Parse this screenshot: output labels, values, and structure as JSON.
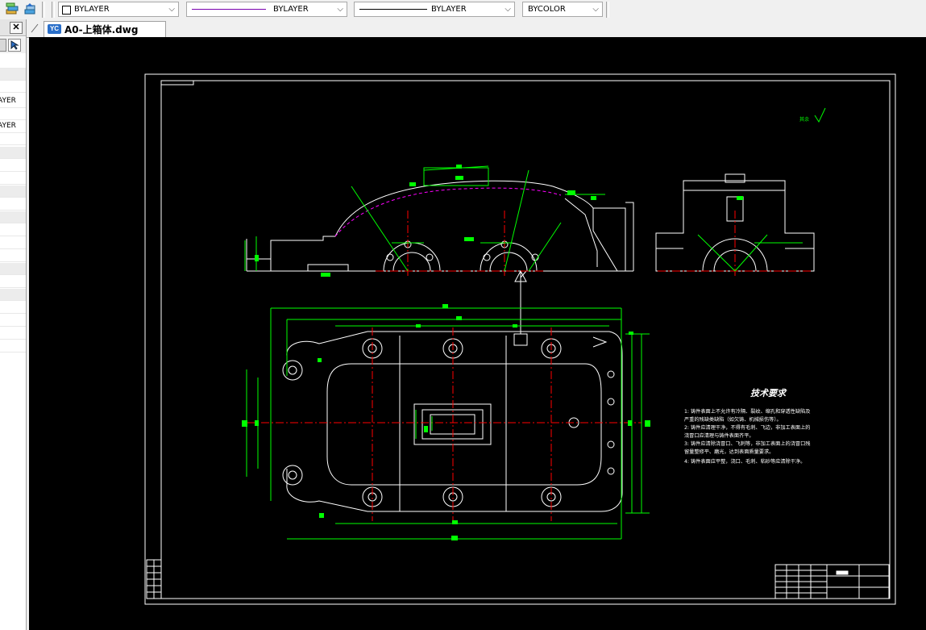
{
  "toolbar": {
    "layer_combo": "BYLAYER",
    "linetype_combo": "BYLAYER",
    "lineweight_combo": "BYLAYER",
    "color_combo": "BYCOLOR"
  },
  "left_panel": {
    "rows": [
      "AYER",
      "AYER"
    ]
  },
  "document_tab": {
    "title": "A0-上箱体.dwg",
    "icon_text": "YC"
  },
  "drawing": {
    "tech_title": "技术要求",
    "tech_notes": [
      "1: 铸件表面上不允许有冷隔、裂纹、缩孔和穿透性缺陷及",
      "严重的残缺类缺陷（如欠铸、机械损伤等）。",
      "2: 铸件应清理干净，不得有毛刺、飞边，非加工表面上的",
      "浇冒口应清理与铸件表面齐平。",
      "3: 铸件应清除浇冒口、飞刺等，非加工表面上的浇冒口残",
      "留量整修平、磨光，达到表面质量要求。",
      "4: 铸件表面应平整，浇口、毛刺、粘砂等应清除干净。"
    ],
    "roughness_label": "其余",
    "colors": {
      "background": "#000000",
      "outline": "#ffffff",
      "dimension": "#00ff00",
      "center": "#ff0000",
      "hidden": "#ff00ff"
    }
  }
}
